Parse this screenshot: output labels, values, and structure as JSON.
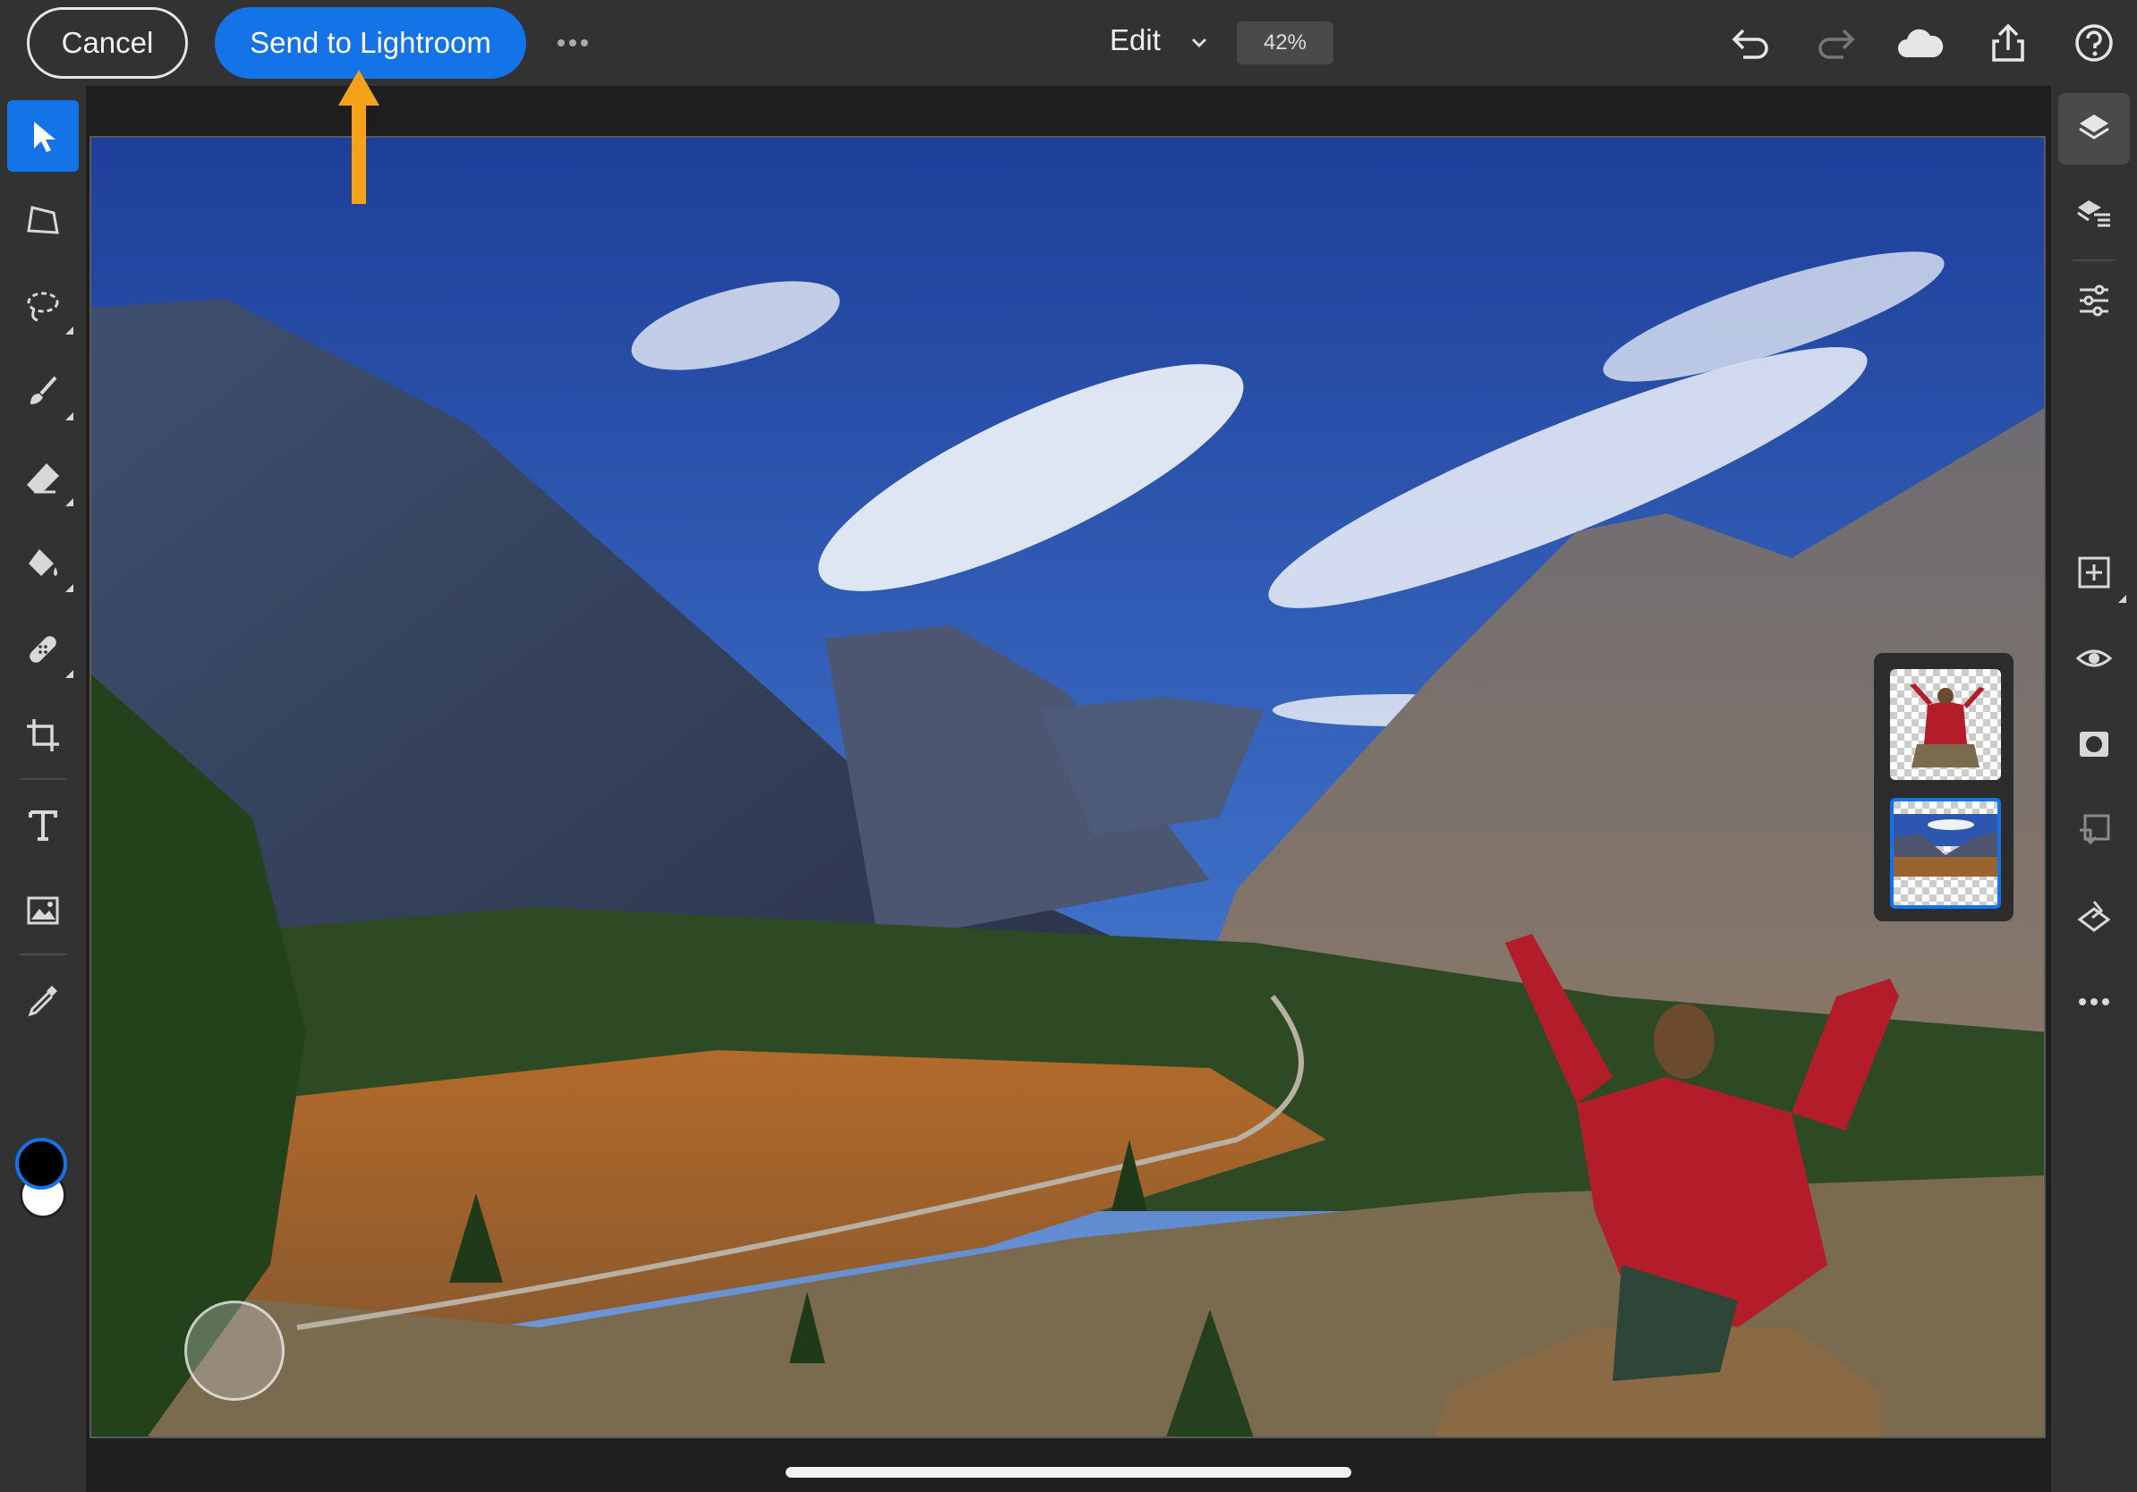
{
  "topbar": {
    "cancel_label": "Cancel",
    "send_label": "Send to Lightroom",
    "more_icon": "more-horizontal-icon",
    "mode_label": "Edit",
    "zoom": "42%",
    "icons": [
      "undo-icon",
      "redo-icon",
      "cloud-icon",
      "share-icon",
      "help-icon"
    ]
  },
  "left_toolbar": {
    "tools": [
      "select-tool",
      "transform-tool",
      "lasso-tool",
      "brush-tool",
      "eraser-tool",
      "fill-tool",
      "heal-tool",
      "crop-tool",
      "type-tool",
      "place-image-tool",
      "eyedropper-tool"
    ],
    "active_tool": "select-tool",
    "foreground_color": "#000000",
    "background_color": "#ffffff"
  },
  "right_toolbar": {
    "tools": [
      "layers-icon",
      "layer-properties-icon",
      "adjustments-icon",
      "add-layer-icon",
      "visibility-icon",
      "mask-icon",
      "clip-icon",
      "lightroom-icon",
      "more-icon"
    ]
  },
  "layers": [
    {
      "name": "person-cutout",
      "selected": false
    },
    {
      "name": "landscape",
      "selected": true
    }
  ],
  "colors": {
    "accent": "#1473e6",
    "arrow": "#f39c12",
    "chrome": "#323232"
  }
}
